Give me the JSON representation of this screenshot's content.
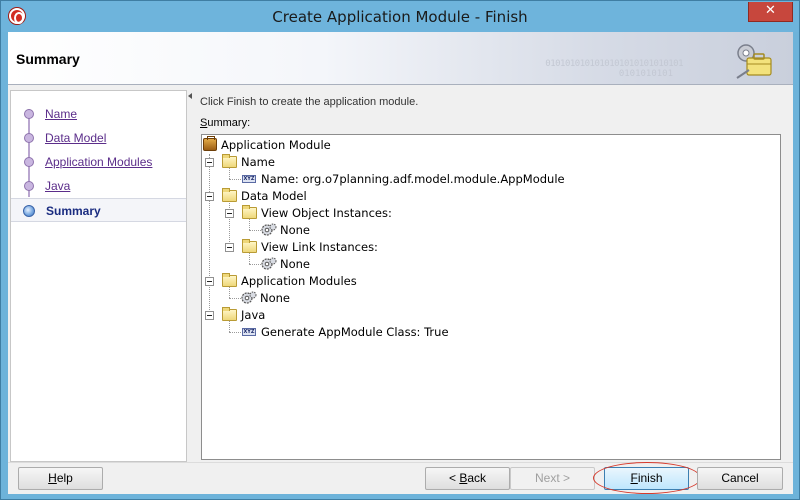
{
  "window": {
    "title": "Create Application Module - Finish",
    "close_glyph": "✕"
  },
  "header": {
    "title": "Summary",
    "binary_text_1": "0101010101010101010101010101",
    "binary_text_2": "0101010101",
    "icon": "briefcase-gear-icon"
  },
  "nav": {
    "items": [
      {
        "label": "Name",
        "selected": false
      },
      {
        "label": "Data Model",
        "selected": false
      },
      {
        "label": "Application Modules",
        "selected": false
      },
      {
        "label": "Java",
        "selected": false
      },
      {
        "label": "Summary",
        "selected": true
      }
    ]
  },
  "main": {
    "instruction": "Click Finish to create the application module.",
    "summary_label_mnemonic": "S",
    "summary_label_rest": "ummary:",
    "tree": {
      "root": "Application Module",
      "name_section": "Name",
      "name_value": "Name: org.o7planning.adf.model.module.AppModule",
      "data_model_section": "Data Model",
      "view_object_instances": "View Object Instances:",
      "view_object_value": "None",
      "view_link_instances": "View Link Instances:",
      "view_link_value": "None",
      "app_modules_section": "Application Modules",
      "app_modules_value": "None",
      "java_section": "Java",
      "java_value": "Generate AppModule Class: True",
      "xyz_icon_text": "XYZ"
    }
  },
  "footer": {
    "help_mnemonic": "H",
    "help_rest": "elp",
    "back_prefix": "< ",
    "back_mnemonic": "B",
    "back_rest": "ack",
    "next_label": "Next >",
    "finish_mnemonic": "F",
    "finish_rest": "inish",
    "cancel_label": "Cancel"
  },
  "colors": {
    "titlebar": "#6eb4dc",
    "nav_link": "#5b2d8a",
    "nav_selected": "#1a2c80",
    "highlight_circle": "#d63a2c"
  }
}
